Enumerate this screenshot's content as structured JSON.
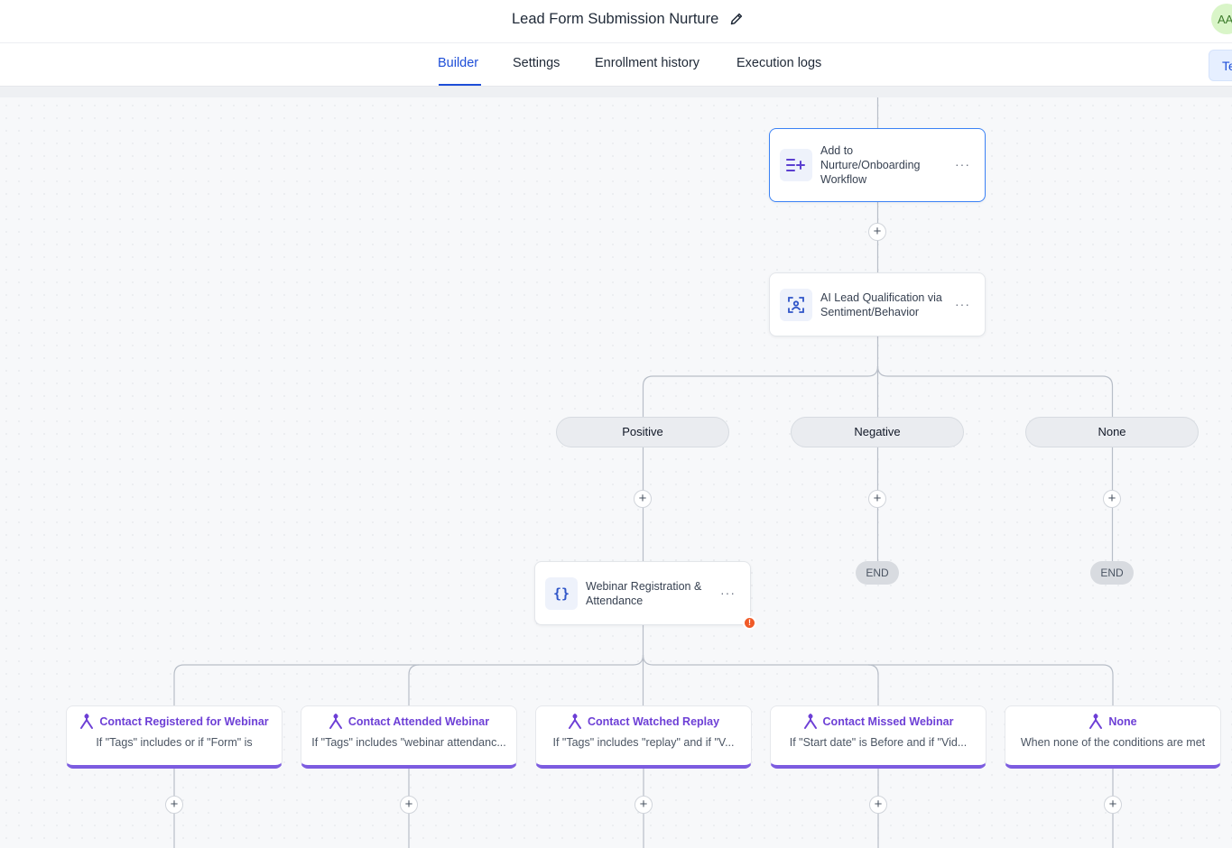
{
  "header": {
    "title": "Lead Form Submission Nurture",
    "avatar_initials": "AA"
  },
  "tabs": [
    {
      "label": "Builder",
      "active": true
    },
    {
      "label": "Settings"
    },
    {
      "label": "Enrollment history"
    },
    {
      "label": "Execution logs"
    }
  ],
  "test_button": {
    "label": "Te"
  },
  "workflow": {
    "nodes": [
      {
        "label": "Add to Nurture/Onboarding Workflow",
        "icon": "add-to-workflow-icon",
        "more": "···"
      },
      {
        "label": "AI Lead Qualification via Sentiment/Behavior",
        "icon": "ai-scan-icon",
        "more": "···"
      },
      {
        "label": "Webinar Registration & Attendance",
        "icon": "code-braces-icon",
        "more": "···",
        "warning": "!"
      }
    ],
    "sentiment_branches": [
      "Positive",
      "Negative",
      "None"
    ],
    "end_label": "END",
    "plus": "+",
    "condition_branches": [
      {
        "title": "Contact Registered for Webinar",
        "condition": "If \"Tags\" includes or if \"Form\" is"
      },
      {
        "title": "Contact Attended Webinar",
        "condition": "If \"Tags\" includes \"webinar attendanc..."
      },
      {
        "title": "Contact Watched Replay",
        "condition": "If \"Tags\" includes \"replay\" and if \"V..."
      },
      {
        "title": "Contact Missed Webinar",
        "condition": "If \"Start date\" is Before and if \"Vid..."
      },
      {
        "title": "None",
        "condition": "When none of the conditions are met"
      }
    ]
  },
  "colors": {
    "accent": "#1d4ed8",
    "branch": "#7c5ce0",
    "warning": "#f05a28"
  }
}
